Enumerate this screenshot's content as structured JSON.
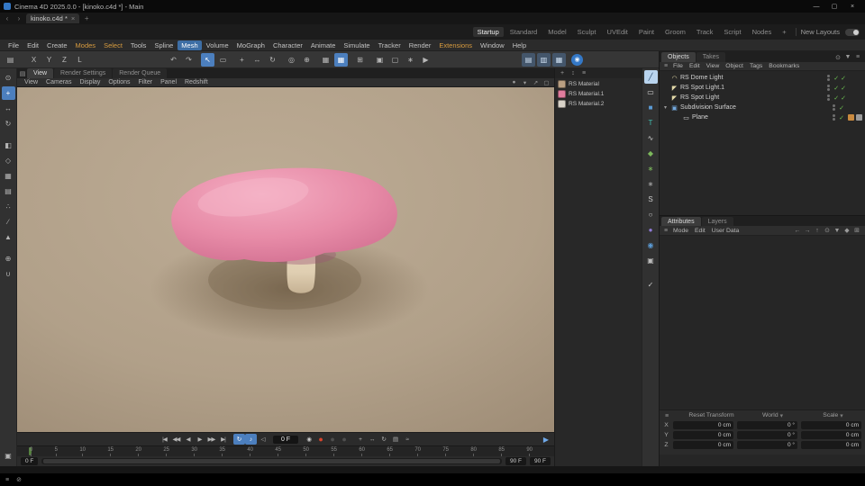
{
  "window": {
    "title": "Cinema 4D 2025.0.0 - [kinoko.c4d *] - Main",
    "minimize": "—",
    "maximize": "▢",
    "close": "×"
  },
  "docbar": {
    "back": "‹",
    "forward": "›",
    "tab": "kinoko.c4d *",
    "tab_close": "×",
    "add_tab": "+"
  },
  "layouts": {
    "items": [
      {
        "label": "Startup",
        "variant": "active",
        "name": "layout-startup"
      },
      {
        "label": "Standard",
        "name": "layout-standard"
      },
      {
        "label": "Model",
        "name": "layout-model"
      },
      {
        "label": "Sculpt",
        "name": "layout-sculpt"
      },
      {
        "label": "UVEdit",
        "name": "layout-uvedit"
      },
      {
        "label": "Paint",
        "name": "layout-paint"
      },
      {
        "label": "Groom",
        "name": "layout-groom"
      },
      {
        "label": "Track",
        "name": "layout-track"
      },
      {
        "label": "Script",
        "name": "layout-script"
      },
      {
        "label": "Nodes",
        "name": "layout-nodes"
      },
      {
        "label": "+",
        "name": "add-layout-button"
      }
    ],
    "new_layouts": "New Layouts"
  },
  "menubar": {
    "items": [
      {
        "label": "File"
      },
      {
        "label": "Edit"
      },
      {
        "label": "Create"
      },
      {
        "label": "Modes",
        "variant": "amber"
      },
      {
        "label": "Select",
        "variant": "amber"
      },
      {
        "label": "Tools"
      },
      {
        "label": "Spline"
      },
      {
        "label": "Mesh",
        "variant": "selected"
      },
      {
        "label": "Volume"
      },
      {
        "label": "MoGraph"
      },
      {
        "label": "Character"
      },
      {
        "label": "Animate"
      },
      {
        "label": "Simulate"
      },
      {
        "label": "Tracker"
      },
      {
        "label": "Render"
      },
      {
        "label": "Extensions",
        "variant": "amber"
      },
      {
        "label": "Window"
      },
      {
        "label": "Help"
      }
    ]
  },
  "toolbar": {
    "items": [
      {
        "name": "app-menu-icon",
        "glyph": "▤"
      },
      {
        "name": "axis-x-lock-button",
        "glyph": "X",
        "style": "margin-left:10px"
      },
      {
        "name": "axis-y-lock-button",
        "glyph": "Y"
      },
      {
        "name": "axis-z-lock-button",
        "glyph": "Z"
      },
      {
        "name": "workplane-lock-button",
        "glyph": "L"
      },
      {
        "name": "undo-button",
        "glyph": "↶",
        "style": "margin-left:88px"
      },
      {
        "name": "redo-button",
        "glyph": "↷"
      },
      {
        "name": "live-selection-tool",
        "glyph": "↖",
        "variant": "active",
        "style": "margin-left:5px"
      },
      {
        "name": "rectangle-selection-tool",
        "glyph": "▭"
      },
      {
        "name": "move-tool",
        "glyph": "+",
        "style": "margin-left:5px"
      },
      {
        "name": "scale-tool",
        "glyph": "↔"
      },
      {
        "name": "rotate-tool",
        "glyph": "↻"
      },
      {
        "name": "last-tool-button",
        "glyph": "◎",
        "style": "margin-left:5px"
      },
      {
        "name": "coordinate-system-toggle",
        "glyph": "⊕"
      },
      {
        "name": "snap-toggle",
        "glyph": "▦",
        "style": "margin-left:5px"
      },
      {
        "name": "quantize-toggle",
        "glyph": "▦",
        "variant": "active"
      },
      {
        "name": "modeling-settings-button",
        "glyph": "⊞",
        "style": "margin-left:5px"
      },
      {
        "name": "render-view-button",
        "glyph": "▣",
        "style": "margin-left:6px"
      },
      {
        "name": "render-region-button",
        "glyph": "▢"
      },
      {
        "name": "render-settings-button",
        "glyph": "∗"
      },
      {
        "name": "interactive-render-button",
        "glyph": "▶"
      },
      {
        "name": "view-layout-single-button",
        "glyph": "▤",
        "variant": "panel",
        "style": "margin-left:98px"
      },
      {
        "name": "view-layout-split-button",
        "glyph": "▥",
        "variant": "panel"
      },
      {
        "name": "view-layout-quad-button",
        "glyph": "▦",
        "variant": "panel"
      },
      {
        "name": "redshift-render-button",
        "glyph": "◉",
        "variant": "redshift",
        "style": "margin-left:5px"
      }
    ]
  },
  "left_palette": {
    "items": [
      {
        "name": "viewport-solo-button",
        "glyph": "⊙"
      },
      {
        "name": "move-tool",
        "glyph": "+",
        "variant": "active"
      },
      {
        "name": "scale-tool",
        "glyph": "↔"
      },
      {
        "name": "rotate-tool",
        "glyph": "↻"
      },
      {
        "name": "make-editable-button",
        "glyph": "◧",
        "style": "margin-top:7px"
      },
      {
        "name": "model-mode-button",
        "glyph": "◇"
      },
      {
        "name": "texture-mode-button",
        "glyph": "▦"
      },
      {
        "name": "workplane-mode-button",
        "glyph": "▤"
      },
      {
        "name": "points-mode-button",
        "glyph": "∴"
      },
      {
        "name": "edges-mode-button",
        "glyph": "∕"
      },
      {
        "name": "polygons-mode-button",
        "glyph": "▲"
      },
      {
        "name": "enable-axis-button",
        "glyph": "⊕",
        "style": "margin-top:7px"
      },
      {
        "name": "snap-toggle",
        "glyph": "∪"
      },
      {
        "name": "axis-gizmo-button",
        "glyph": "▣",
        "style": "margin-top:auto"
      }
    ]
  },
  "viewport": {
    "panel_icon": "▤",
    "tabs": [
      {
        "label": "View",
        "variant": "active",
        "name": "tab-view"
      },
      {
        "label": "Render Settings",
        "name": "tab-render-settings"
      },
      {
        "label": "Render Queue",
        "name": "tab-render-queue"
      }
    ],
    "menu": [
      {
        "label": "View"
      },
      {
        "label": "Cameras"
      },
      {
        "label": "Display"
      },
      {
        "label": "Options"
      },
      {
        "label": "Filter"
      },
      {
        "label": "Panel"
      },
      {
        "label": "Redshift"
      }
    ],
    "corner_icons": [
      {
        "name": "camera-icon",
        "glyph": "●"
      },
      {
        "name": "grid-toggle-icon",
        "glyph": "▾"
      },
      {
        "name": "popout-view-icon",
        "glyph": "↗"
      },
      {
        "name": "maximize-view-icon",
        "glyph": "▢"
      }
    ],
    "scene": {
      "background": "#b3a28b",
      "shadow": "#6f5d46",
      "mushroom_cap": "#e78ba7",
      "cap_highlight": "#f4adc2",
      "stem": "#e6d7bd"
    }
  },
  "materials": {
    "header_icons": [
      {
        "name": "add-material-icon",
        "glyph": "+"
      },
      {
        "name": "sort-icon",
        "glyph": "↕"
      },
      {
        "name": "material-menu-icon",
        "glyph": "≡"
      }
    ],
    "items": [
      {
        "name": "RS Material",
        "swatch": "background:#b99f82"
      },
      {
        "name": "RS Material.1",
        "swatch": "background:#e07c9d"
      },
      {
        "name": "RS Material.2",
        "swatch": "background:#d9d3c9"
      }
    ]
  },
  "right_strip": {
    "items": [
      {
        "name": "pen-tool-icon",
        "glyph": "╱",
        "variant": "active"
      },
      {
        "name": "plane-primitive-icon",
        "glyph": "▭",
        "style": "color:#d8d8d8"
      },
      {
        "name": "cube-primitive-icon",
        "glyph": "■",
        "style": "color:#5b9bd5"
      },
      {
        "name": "text-primitive-icon",
        "glyph": "T",
        "style": "color:#3fbdb0"
      },
      {
        "name": "spline-pen-icon",
        "glyph": "∿",
        "style": "color:#cccccc"
      },
      {
        "name": "mograph-cloner-icon",
        "glyph": "◆",
        "style": "color:#7cb85c"
      },
      {
        "name": "simulation-gear-icon",
        "glyph": "∗",
        "style": "color:#7cb85c"
      },
      {
        "name": "deformer-gear-icon",
        "glyph": "∗",
        "style": "color:#aaaaaa"
      },
      {
        "name": "spline-arc-icon",
        "glyph": "S",
        "style": "color:#cccccc"
      },
      {
        "name": "spline-circle-icon",
        "glyph": "○",
        "style": "color:#cccccc"
      },
      {
        "name": "volume-builder-icon",
        "glyph": "●",
        "style": "color:#8f7ad6"
      },
      {
        "name": "field-sphere-icon",
        "glyph": "◉",
        "style": "color:#5b9bd5"
      },
      {
        "name": "camera-icon",
        "glyph": "▣",
        "style": "color:#bbbbbb"
      },
      {
        "name": "apply-check-icon",
        "glyph": "✓",
        "style": "margin-top:10px;color:#cccccc"
      }
    ]
  },
  "objects_panel": {
    "tabs": [
      {
        "label": "Objects",
        "variant": "active",
        "name": "tab-objects"
      },
      {
        "label": "Takes",
        "name": "tab-takes"
      }
    ],
    "header_icons": [
      {
        "name": "search-icon",
        "glyph": "⊙"
      },
      {
        "name": "filter-icon",
        "glyph": "▼"
      },
      {
        "name": "panel-menu-icon",
        "glyph": "≡"
      }
    ],
    "menu_icon": "≡",
    "menu": [
      {
        "label": "File"
      },
      {
        "label": "Edit"
      },
      {
        "label": "View"
      },
      {
        "label": "Object"
      },
      {
        "label": "Tags"
      },
      {
        "label": "Bookmarks"
      }
    ],
    "items": [
      {
        "name": "RS Dome Light",
        "glyph": "◠",
        "icon_style": "color:#e3d9a8",
        "check": "✓",
        "check2": "✓"
      },
      {
        "name": "RS Spot Light.1",
        "glyph": "◤",
        "icon_style": "color:#e3d9a8",
        "check": "✓",
        "check2": "✓"
      },
      {
        "name": "RS Spot Light",
        "glyph": "◤",
        "icon_style": "color:#e3d9a8",
        "check": "✓",
        "check2": "✓"
      },
      {
        "name": "Subdivision Surface",
        "expander": "▾",
        "glyph": "▣",
        "icon_style": "color:#74a9de",
        "check": "✓"
      },
      {
        "name": "Plane",
        "glyph": "▭",
        "icon_style": "color:#d8d8d8",
        "row_style": "padding-left:16px",
        "check": "✓",
        "tag1": "background:#c98a3f",
        "tag2": "background:#9a9a9a"
      }
    ]
  },
  "attributes_panel": {
    "tabs": [
      {
        "label": "Attributes",
        "variant": "active",
        "name": "tab-attributes"
      },
      {
        "label": "Layers",
        "name": "tab-layers"
      }
    ],
    "menu_icon": "≡",
    "menu": [
      {
        "label": "Mode"
      },
      {
        "label": "Edit"
      },
      {
        "label": "User Data"
      }
    ],
    "icons": [
      {
        "name": "history-back-icon",
        "glyph": "←"
      },
      {
        "name": "history-forward-icon",
        "glyph": "→"
      },
      {
        "name": "parent-object-icon",
        "glyph": "↑"
      },
      {
        "name": "search-icon",
        "glyph": "⊙"
      },
      {
        "name": "filter-icon",
        "glyph": "▼"
      },
      {
        "name": "lock-icon",
        "glyph": "◆"
      },
      {
        "name": "new-panel-icon",
        "glyph": "⊞"
      }
    ]
  },
  "coordinates": {
    "menu_icon": "≡",
    "headers": [
      {
        "label": "Reset Transform"
      },
      {
        "label": "World",
        "arrow": "▾"
      },
      {
        "label": "Scale",
        "arrow": "▾"
      }
    ],
    "rows": [
      {
        "axis": "X",
        "position": "0 cm",
        "rotation": "0 °",
        "size": "0 cm"
      },
      {
        "axis": "Y",
        "position": "0 cm",
        "rotation": "0 °",
        "size": "0 cm"
      },
      {
        "axis": "Z",
        "position": "0 cm",
        "rotation": "0 °",
        "size": "0 cm"
      }
    ]
  },
  "transport": {
    "buttons": [
      {
        "name": "goto-start-button",
        "glyph": "|◀"
      },
      {
        "name": "previous-key-button",
        "glyph": "◀◀"
      },
      {
        "name": "previous-frame-button",
        "glyph": "◀"
      },
      {
        "name": "play-button",
        "glyph": "▶"
      },
      {
        "name": "next-frame-button",
        "glyph": "▶▶"
      },
      {
        "name": "goto-end-button",
        "glyph": "▶|"
      },
      {
        "name": "loop-toggle",
        "glyph": "↻",
        "variant": "active",
        "style": "margin-left:5px"
      },
      {
        "name": "sound-toggle",
        "glyph": "♪",
        "variant": "active"
      },
      {
        "name": "volume-button",
        "glyph": "◁"
      }
    ],
    "record_buttons": [
      {
        "name": "record-keyframe-button",
        "glyph": "◉",
        "style": "color:#c9c9c9"
      },
      {
        "name": "autokey-toggle",
        "glyph": "●",
        "style": "color:#d8442c;font-size:9px"
      },
      {
        "name": "keyframe-selection-button",
        "glyph": "●",
        "style": "color:#4e4e4e;font-size:9px"
      },
      {
        "name": "keyframe-presets-button",
        "glyph": "●",
        "style": "color:#4e4e4e;font-size:9px"
      },
      {
        "name": "key-position-toggle",
        "glyph": "+",
        "style": "margin-left:5px"
      },
      {
        "name": "key-scale-toggle",
        "glyph": "↔"
      },
      {
        "name": "key-rotation-toggle",
        "glyph": "↻"
      },
      {
        "name": "key-parameter-toggle",
        "glyph": "▤"
      },
      {
        "name": "key-pla-toggle",
        "glyph": "≈"
      }
    ],
    "ram_player": {
      "glyph": "▶"
    }
  },
  "timeline": {
    "current_frame": "0 F",
    "ticks": [
      "0",
      "5",
      "10",
      "15",
      "20",
      "25",
      "30",
      "35",
      "40",
      "45",
      "50",
      "55",
      "60",
      "65",
      "70",
      "75",
      "80",
      "85",
      "90"
    ],
    "range_start": "0 F",
    "range_end": "90 F",
    "range_max": "90 F"
  },
  "status": {
    "menu_icon": "≡",
    "error_icon": "⊘"
  }
}
